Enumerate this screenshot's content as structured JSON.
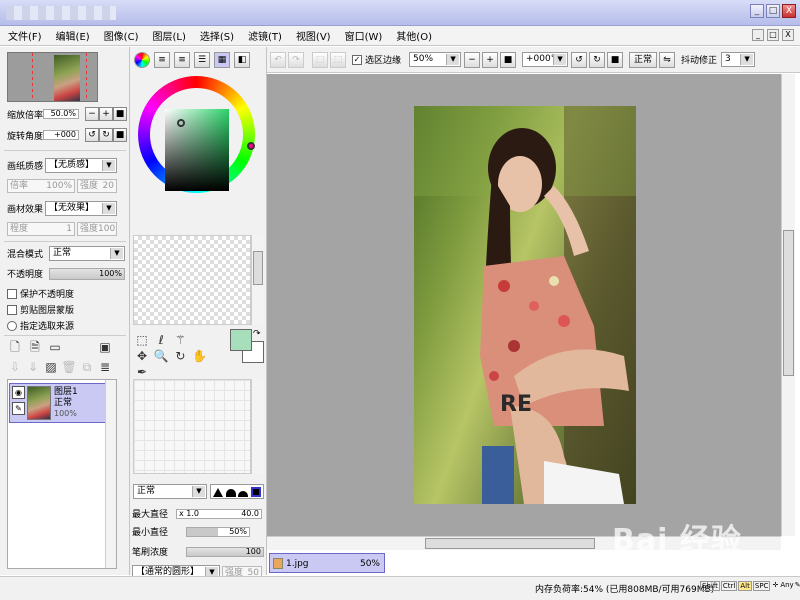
{
  "menu": [
    "文件(F)",
    "编辑(E)",
    "图像(C)",
    "图层(L)",
    "选择(S)",
    "滤镜(T)",
    "视图(V)",
    "窗口(W)",
    "其他(O)"
  ],
  "window_buttons": {
    "min": "_",
    "max": "□",
    "close": "X"
  },
  "navigator": {
    "zoom_label": "缩放倍率",
    "zoom_value": "50.0%",
    "rotate_label": "旋转角度",
    "rotate_value": "+000"
  },
  "paper": {
    "quality_label": "画纸质感",
    "quality_value": "【无质感】",
    "ratio_label": "倍率",
    "ratio_value": "100%",
    "strength_label": "强度",
    "strength_value": "20",
    "effect_label": "画材效果",
    "effect_value": "【无效果】",
    "degree_label": "程度",
    "degree_value": "1",
    "strength2_label": "强度",
    "strength2_value": "100"
  },
  "layer_props": {
    "blend_label": "混合模式",
    "blend_value": "正常",
    "opacity_label": "不透明度",
    "opacity_value": "100%",
    "preserve_opacity": "保护不透明度",
    "clipping": "剪贴图层蒙版",
    "selection_source": "指定选取来源"
  },
  "layer": {
    "name": "图层1",
    "mode": "正常",
    "opacity": "100%"
  },
  "brush": {
    "mode": "正常",
    "max_label": "最大直径",
    "max_mult": "x 1.0",
    "max_value": "40.0",
    "min_label": "最小直径",
    "min_value": "50%",
    "density_label": "笔刷浓度",
    "density_value": "100",
    "shape_value": "【通常的圆形】",
    "shape_strength_label": "强度",
    "shape_strength_value": "50",
    "level": 1.0
  },
  "toolbar": {
    "edge_label": "选区边缘",
    "zoom_value": "50%",
    "rotation_value": "+000°",
    "mode_value": "正常",
    "stabilizer_label": "抖动修正",
    "stabilizer_value": "3"
  },
  "file_tab": {
    "name": "1.jpg",
    "zoom": "50%"
  },
  "status": {
    "memory": "内存负荷率:54% (已用808MB/可用769MB)",
    "keys": [
      "Shift",
      "Ctrl",
      "Alt",
      "SPC"
    ],
    "any": "Any"
  },
  "watermark": "Bai 经验",
  "colors": {
    "accent": "#cac9f4",
    "current_color": "#a7dfbd",
    "canvas_bg": "#a4a4a4"
  }
}
